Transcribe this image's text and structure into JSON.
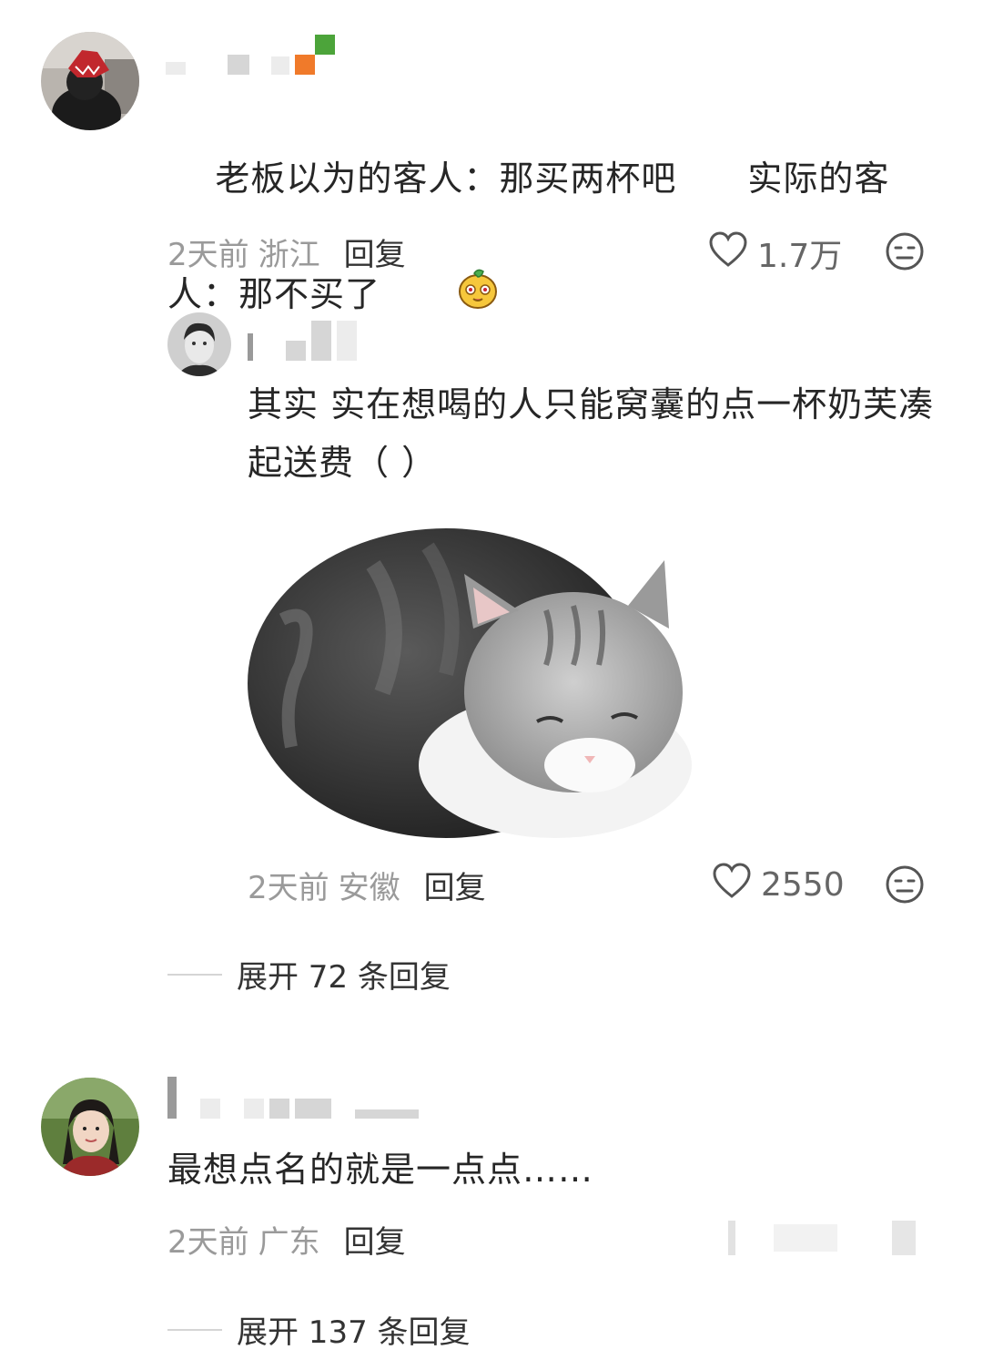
{
  "comments": [
    {
      "text": "老板以为的客人：那买两杯吧　　实际的客人：那不买了",
      "time": "2天前",
      "location": "浙江",
      "reply_label": "回复",
      "likes": "1.7万"
    },
    {
      "text": "其实 实在想喝的人只能窝囊的点一杯奶芙凑起送费（ ）",
      "time": "2天前",
      "location": "安徽",
      "reply_label": "回复",
      "likes": "2550",
      "expand_label": "展开 72 条回复"
    },
    {
      "text": "最想点名的就是一点点……",
      "time": "2天前",
      "location": "广东",
      "reply_label": "回复",
      "expand_label": "展开 137 条回复"
    }
  ],
  "icons": {
    "like": "heart-outline-icon",
    "react": "neutral-face-icon",
    "emoji": "cartoon-face-emoji"
  },
  "colors": {
    "text": "#262626",
    "meta": "#9a9a9a",
    "divider": "#d5d5d5"
  }
}
